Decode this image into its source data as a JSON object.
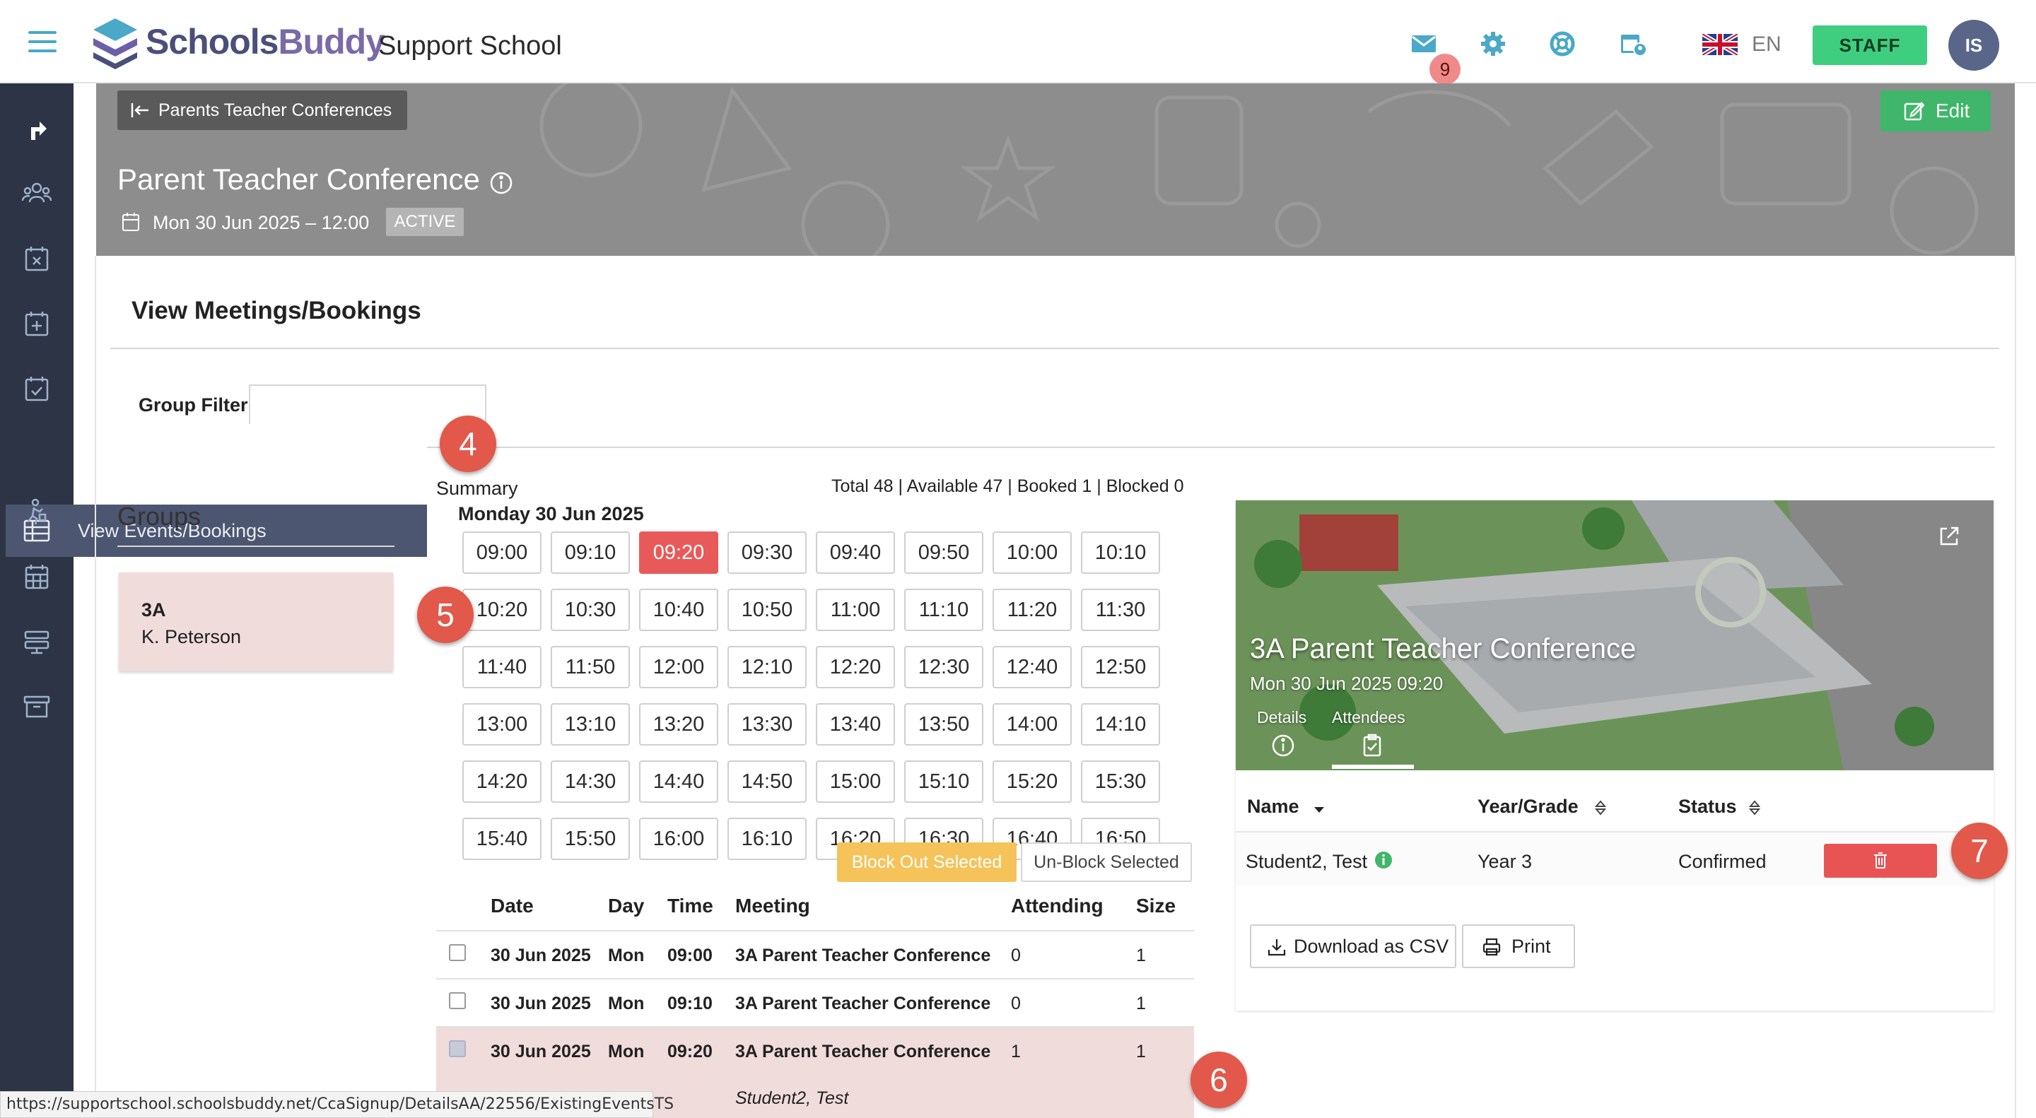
{
  "header": {
    "brand_main": "Schools",
    "brand_accent": "Buddy",
    "school_name": "Support School",
    "mail_count": "9",
    "language": "EN",
    "role_button": "STAFF",
    "user_initials": "IS",
    "icons": [
      "hamburger-icon",
      "mail-icon",
      "gear-icon",
      "lifebuoy-icon",
      "calendar-user-icon",
      "uk-flag-icon"
    ]
  },
  "sidebar": {
    "active_label": "View Events/Bookings",
    "icons": [
      "share-icon",
      "users-icon",
      "calendar-x-icon",
      "calendar-plus-icon",
      "calendar-check-icon",
      "table-icon",
      "person-run-icon",
      "calendar-grid-icon",
      "list-stack-icon",
      "archive-icon"
    ]
  },
  "hero": {
    "back_label": "Parents Teacher Conferences",
    "edit_label": "Edit",
    "title": "Parent Teacher Conference",
    "date": "Mon 30 Jun 2025 – 12:00",
    "status": "ACTIVE"
  },
  "main": {
    "section_title": "View Meetings/Bookings",
    "group_filter_label": "Group Filter",
    "group_filter_value": ""
  },
  "groups": {
    "title": "Groups",
    "items": [
      {
        "name": "3A",
        "teacher": "K. Peterson"
      }
    ]
  },
  "summary": {
    "label": "Summary",
    "totals": "Total 48 | Available 47 | Booked 1 | Blocked 0",
    "day": "Monday 30 Jun 2025",
    "selected_slot": "09:20",
    "slots": [
      "09:00",
      "09:10",
      "09:20",
      "09:30",
      "09:40",
      "09:50",
      "10:00",
      "10:10",
      "10:20",
      "10:30",
      "10:40",
      "10:50",
      "11:00",
      "11:10",
      "11:20",
      "11:30",
      "11:40",
      "11:50",
      "12:00",
      "12:10",
      "12:20",
      "12:30",
      "12:40",
      "12:50",
      "13:00",
      "13:10",
      "13:20",
      "13:30",
      "13:40",
      "13:50",
      "14:00",
      "14:10",
      "14:20",
      "14:30",
      "14:40",
      "14:50",
      "15:00",
      "15:10",
      "15:20",
      "15:30",
      "15:40",
      "15:50",
      "16:00",
      "16:10",
      "16:20",
      "16:30",
      "16:40",
      "16:50"
    ],
    "block_label": "Block Out Selected",
    "unblock_label": "Un-Block Selected"
  },
  "table": {
    "headers": [
      "Date",
      "Day",
      "Time",
      "Meeting",
      "Attending",
      "Size"
    ],
    "rows": [
      {
        "date": "30 Jun 2025",
        "day": "Mon",
        "time": "09:00",
        "meeting": "3A Parent Teacher Conference",
        "attending": "0",
        "size": "1"
      },
      {
        "date": "30 Jun 2025",
        "day": "Mon",
        "time": "09:10",
        "meeting": "3A Parent Teacher Conference",
        "attending": "0",
        "size": "1"
      },
      {
        "date": "30 Jun 2025",
        "day": "Mon",
        "time": "09:20",
        "meeting": "3A Parent Teacher Conference",
        "attending": "1",
        "size": "1"
      }
    ],
    "attendee_name": "Student2, Test"
  },
  "card": {
    "title": "3A Parent Teacher Conference",
    "datetime": "Mon 30 Jun 2025 09:20",
    "tab_details": "Details",
    "tab_attendees": "Attendees",
    "col_name": "Name",
    "col_grade": "Year/Grade",
    "col_status": "Status",
    "row_name": "Student2, Test",
    "row_grade": "Year 3",
    "row_status": "Confirmed",
    "download_label": "Download as CSV",
    "print_label": "Print"
  },
  "callouts": [
    "4",
    "5",
    "6",
    "7"
  ],
  "status_url": "https://supportschool.schoolsbuddy.net/CcaSignup/DetailsAA/22556/ExistingEventsTS",
  "colors": {
    "accent": "#4aa8c8",
    "sidebar": "#2c3446",
    "selected_slot": "#e85a5a",
    "staff_green": "#3fcd80",
    "block_orange": "#f5c35a",
    "highlight_row": "#f1dcdc",
    "callout": "#e2584a"
  }
}
